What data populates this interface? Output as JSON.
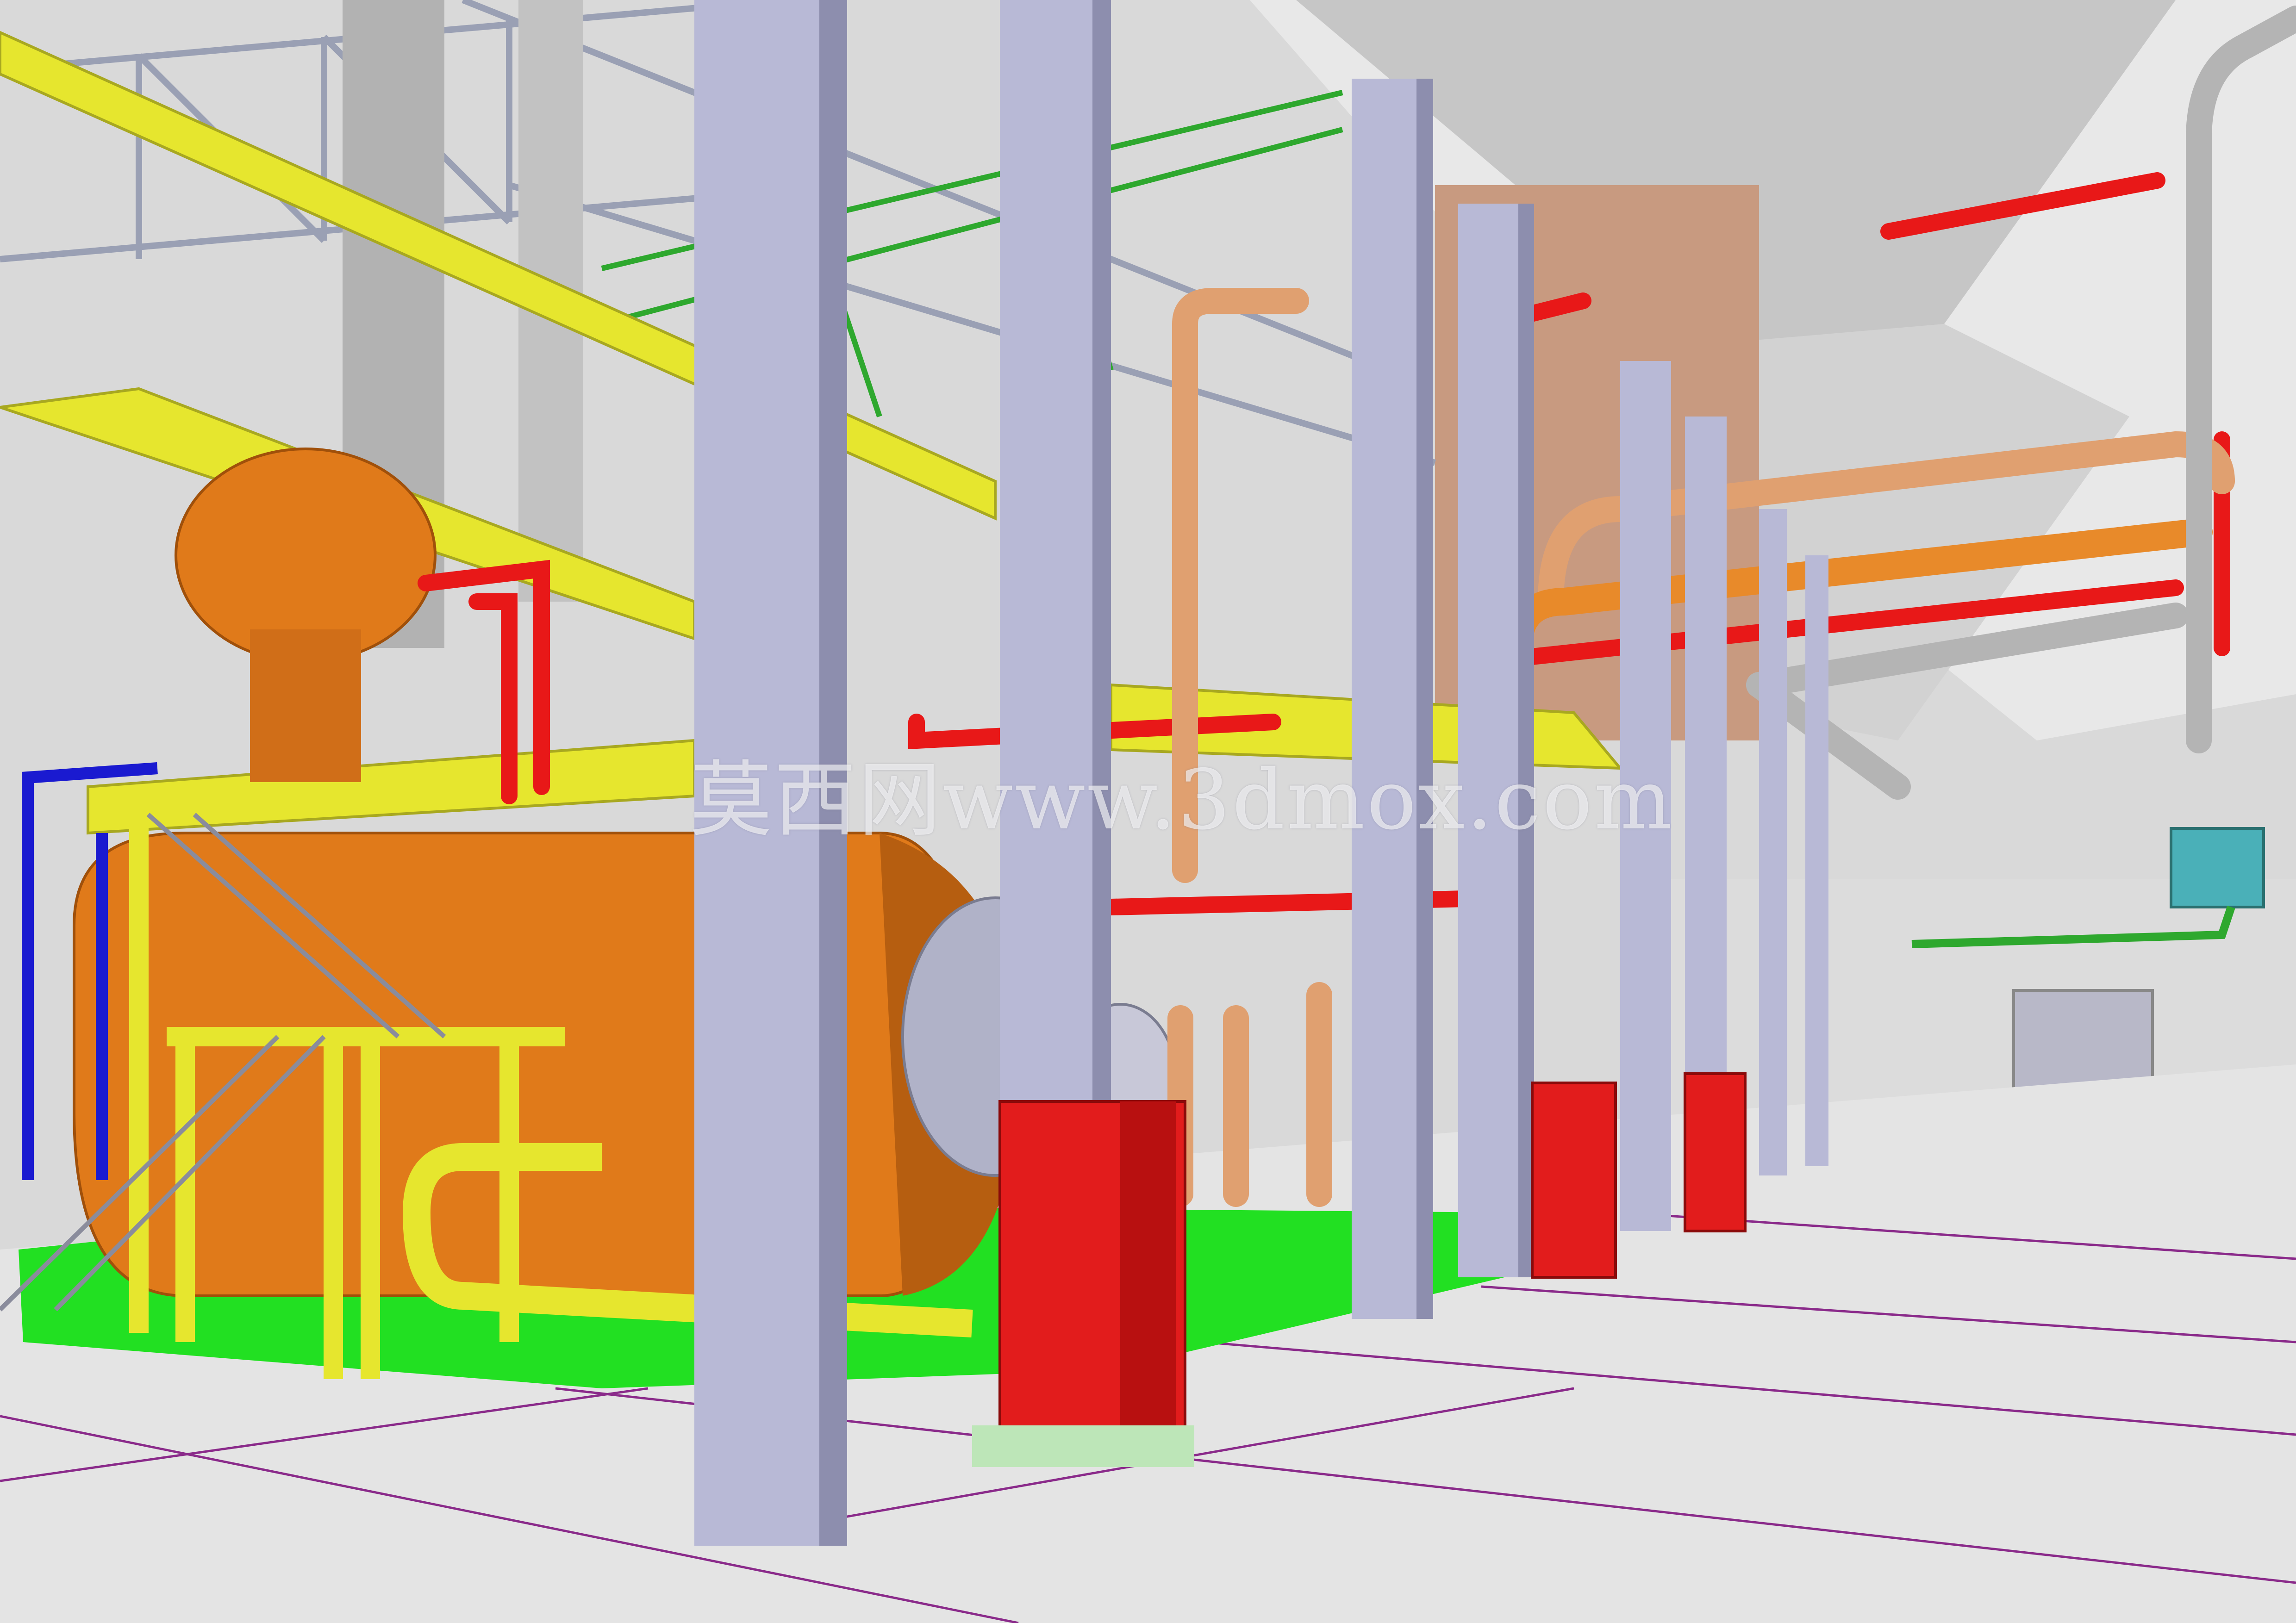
{
  "watermark": {
    "text": "莫西网www.3dmox.com"
  },
  "colors": {
    "floor": "#e4e4e4",
    "floor_lines": "#8a2a8a",
    "green_floor": "#22e022",
    "column": "#b8b9d6",
    "column_shade": "#8d8eae",
    "boiler": "#e07a1a",
    "boiler_shade": "#b65e10",
    "yellow": "#e6e62e",
    "red_pipe": "#e81818",
    "copper_pipe": "#e0a070",
    "orange_pipe": "#e88a2a",
    "grey_pipe": "#b4b4b4",
    "blue_pipe": "#1a1ad0",
    "cabinet": "#e21c1c",
    "cabinet_shade": "#b81010",
    "ceiling": "#cfcfcf",
    "steel": "#9aa0b4",
    "green_truss": "#2ea82e"
  }
}
